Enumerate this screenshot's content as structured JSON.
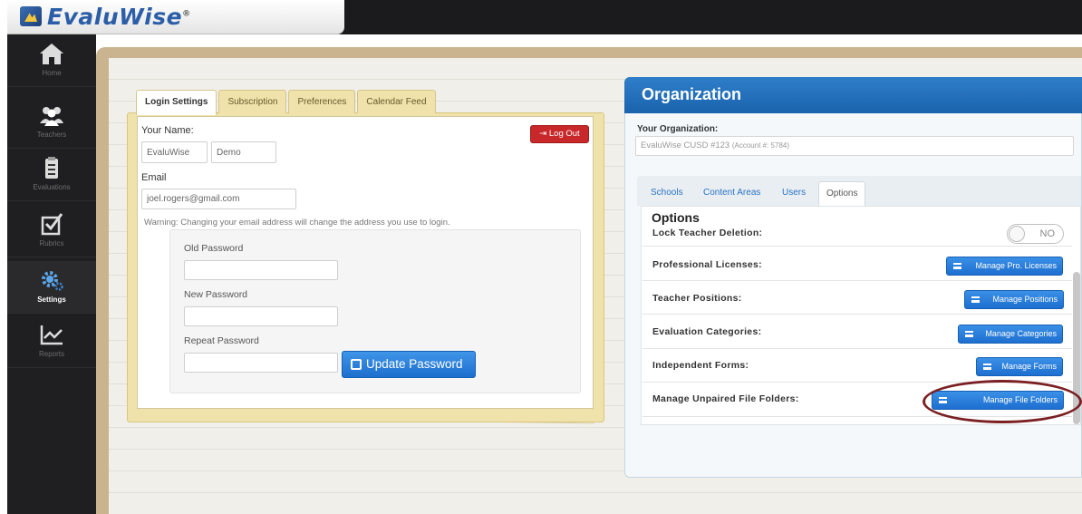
{
  "app": {
    "logo_text": "EvaluWise",
    "logo_mark": "®"
  },
  "sidebar": {
    "items": [
      {
        "label": "Home",
        "icon": "home-icon"
      },
      {
        "label": "Teachers",
        "icon": "teachers-icon"
      },
      {
        "label": "Evaluations",
        "icon": "clipboard-icon"
      },
      {
        "label": "Rubrics",
        "icon": "checkbox-icon"
      },
      {
        "label": "Settings",
        "icon": "gear-icon",
        "active": true
      },
      {
        "label": "Reports",
        "icon": "chart-icon"
      }
    ]
  },
  "login": {
    "tabs": [
      "Login Settings",
      "Subscription",
      "Preferences",
      "Calendar Feed"
    ],
    "your_name_label": "Your Name:",
    "first_name": "EvaluWise",
    "last_name": "Demo",
    "email_label": "Email",
    "email_value": "joel.rogers@gmail.com",
    "warning": "Warning: Changing your email address will change the address you use to login.",
    "logout_label": "Log Out",
    "old_password_label": "Old Password",
    "new_password_label": "New Password",
    "repeat_password_label": "Repeat Password",
    "update_label": "Update Password"
  },
  "org": {
    "title": "Organization",
    "your_org_label": "Your Organization:",
    "org_name": "EvaluWise CUSD #123",
    "account": "(Account #: 5784)",
    "tabs": [
      "Schools",
      "Content Areas",
      "Users",
      "Options"
    ],
    "options_title": "Options",
    "rows": [
      {
        "label": "Lock Teacher Deletion:",
        "toggle": "NO"
      },
      {
        "label": "Professional Licenses:",
        "button": "Manage Pro. Licenses"
      },
      {
        "label": "Teacher Positions:",
        "button": "Manage Positions"
      },
      {
        "label": "Evaluation Categories:",
        "button": "Manage Categories"
      },
      {
        "label": "Independent Forms:",
        "button": "Manage Forms"
      },
      {
        "label": "Manage Unpaired File Folders:",
        "button": "Manage File Folders"
      }
    ]
  },
  "colors": {
    "accent": "#1d6fcd",
    "danger": "#c8282a",
    "annotation": "#7a1f22"
  }
}
